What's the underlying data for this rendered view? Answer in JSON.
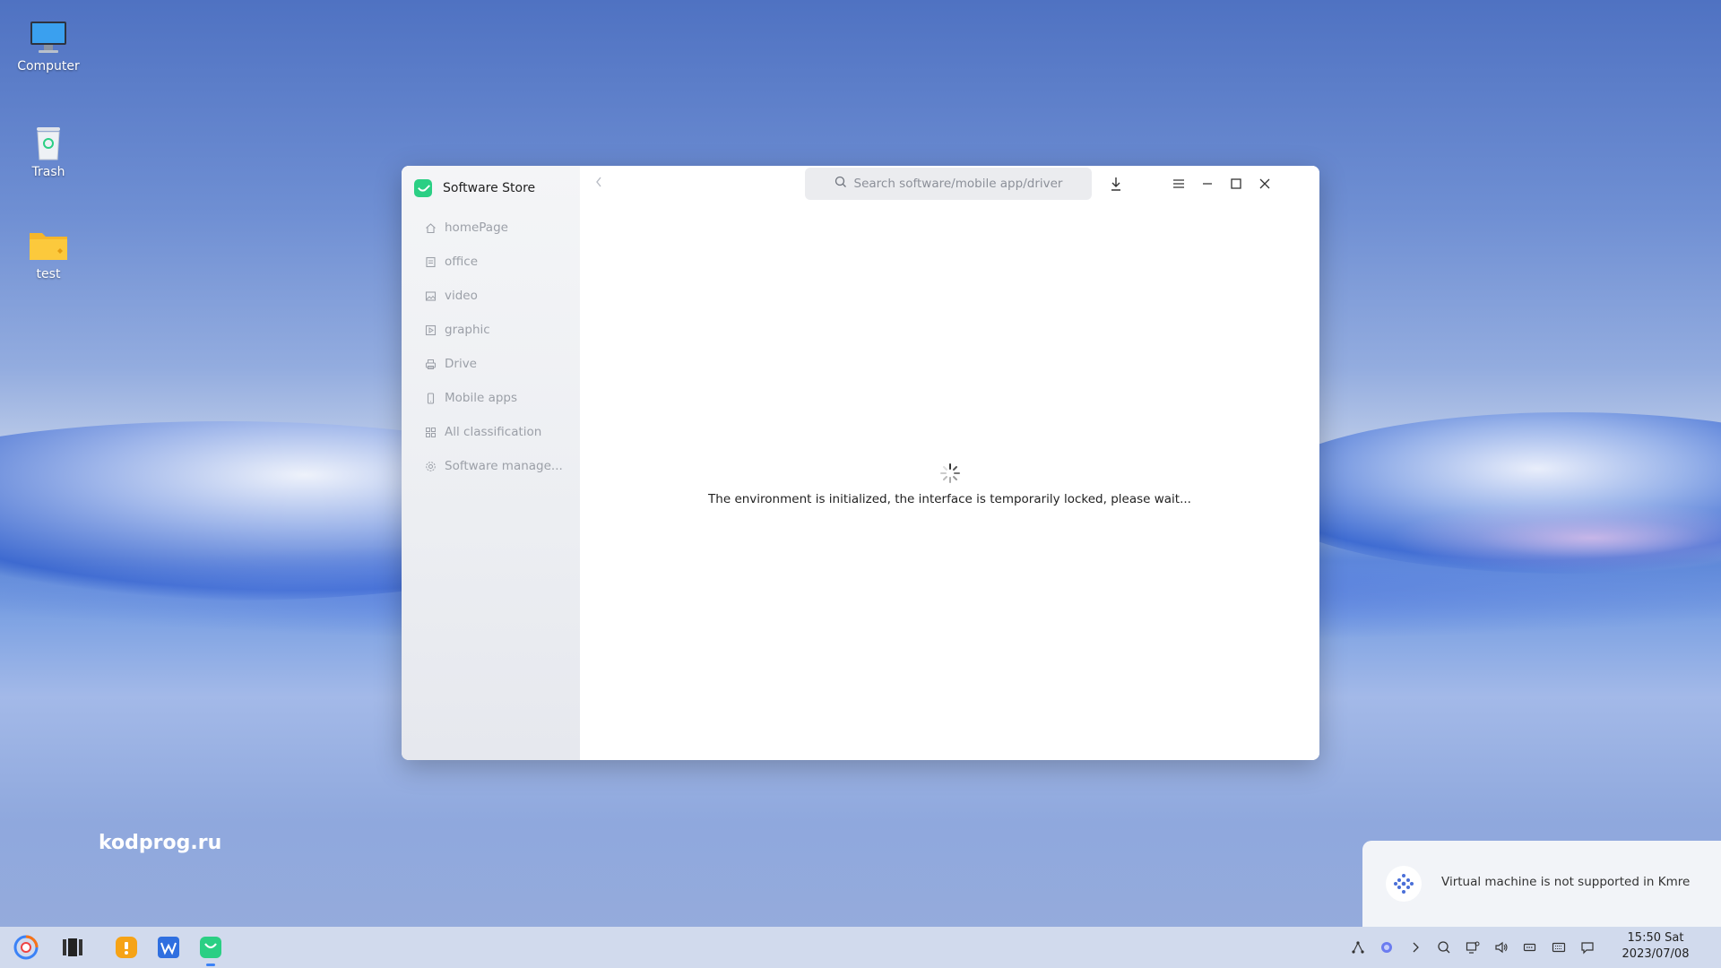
{
  "desktop": {
    "icons": [
      {
        "label": "Computer",
        "icon": "computer-icon"
      },
      {
        "label": "Trash",
        "icon": "trash-icon"
      },
      {
        "label": "test",
        "icon": "folder-icon"
      }
    ],
    "watermark": "kodprog.ru"
  },
  "window": {
    "title": "Software Store",
    "search_placeholder": "Search software/mobile app/driver",
    "nav": [
      {
        "label": "homePage",
        "icon": "home-icon"
      },
      {
        "label": "office",
        "icon": "document-icon"
      },
      {
        "label": "video",
        "icon": "image-icon"
      },
      {
        "label": "graphic",
        "icon": "play-icon"
      },
      {
        "label": "Drive",
        "icon": "printer-icon"
      },
      {
        "label": "Mobile apps",
        "icon": "phone-icon"
      },
      {
        "label": "All classification",
        "icon": "grid-icon"
      },
      {
        "label": "Software manage...",
        "icon": "gear-icon"
      }
    ],
    "loading_message": "The environment is initialized, the interface is temporarily locked, please wait..."
  },
  "notification": {
    "text": "Virtual machine is not supported in Kmre",
    "icon": "kmre-icon"
  },
  "taskbar": {
    "apps": [
      "start-menu-icon",
      "multitask-view-icon",
      "file-manager-icon",
      "wps-icon",
      "software-store-icon"
    ],
    "tray": [
      "network-icon",
      "assistant-icon",
      "expand-tray-icon",
      "search-icon",
      "display-icon",
      "volume-icon",
      "battery-icon",
      "keyboard-icon",
      "notification-center-icon"
    ],
    "time": "15:50 Sat",
    "date": "2023/07/08"
  },
  "colors": {
    "accent": "#2bcf84",
    "sidebar_text": "#9ca0a8"
  }
}
